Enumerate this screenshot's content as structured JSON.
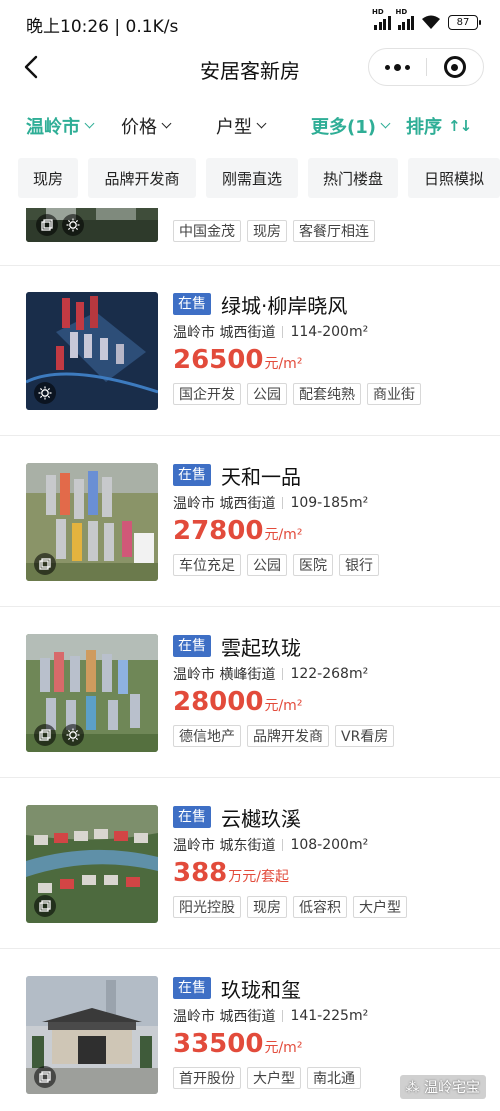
{
  "status_bar": {
    "time": "晚上10:26",
    "speed": "0.1K/s",
    "battery": "87"
  },
  "header": {
    "title": "安居客新房"
  },
  "filters": {
    "city": "温岭市",
    "price": "价格",
    "layout": "户型",
    "more": "更多(1)",
    "sort": "排序",
    "accent_color": "#2fae96"
  },
  "chips": [
    "现房",
    "品牌开发商",
    "刚需直选",
    "热门楼盘",
    "日照模拟"
  ],
  "listings": [
    {
      "tags": [
        "中国金茂",
        "现房",
        "客餐厅相连"
      ]
    },
    {
      "status": "在售",
      "name": "绿城·柳岸晓风",
      "city": "温岭市",
      "street": "城西街道",
      "area": "114-200m²",
      "price": "26500",
      "price_unit": "元/m²",
      "tags": [
        "国企开发",
        "公园",
        "配套纯熟",
        "商业街"
      ]
    },
    {
      "status": "在售",
      "name": "天和一品",
      "city": "温岭市",
      "street": "城西街道",
      "area": "109-185m²",
      "price": "27800",
      "price_unit": "元/m²",
      "tags": [
        "车位充足",
        "公园",
        "医院",
        "银行"
      ]
    },
    {
      "status": "在售",
      "name": "雲起玖珑",
      "city": "温岭市",
      "street": "横峰街道",
      "area": "122-268m²",
      "price": "28000",
      "price_unit": "元/m²",
      "tags": [
        "德信地产",
        "品牌开发商",
        "VR看房"
      ]
    },
    {
      "status": "在售",
      "name": "云樾玖溪",
      "city": "温岭市",
      "street": "城东街道",
      "area": "108-200m²",
      "price": "388",
      "price_unit": "万元/套起",
      "tags": [
        "阳光控股",
        "现房",
        "低容积",
        "大户型"
      ]
    },
    {
      "status": "在售",
      "name": "玖珑和玺",
      "city": "温岭市",
      "street": "城西街道",
      "area": "141-225m²",
      "price": "33500",
      "price_unit": "元/m²",
      "tags": [
        "首开股份",
        "大户型",
        "南北通"
      ]
    }
  ],
  "colors": {
    "price": "#e24b3b",
    "status_badge": "#3e6fc5"
  },
  "watermark": "温岭宅宝"
}
